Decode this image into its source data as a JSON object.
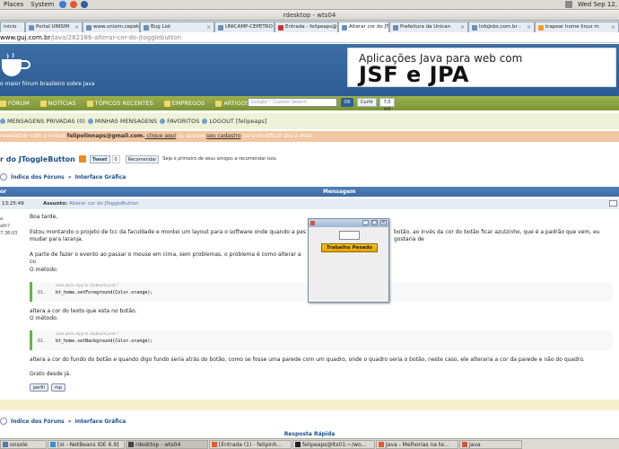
{
  "gnome": {
    "menus": [
      "Places",
      "System"
    ],
    "clock": "Wed Sep 12,"
  },
  "window_title": "rdesktop - wts04",
  "browser": {
    "tabs": [
      {
        "label": "inicio"
      },
      {
        "label": "Portal UNISIM"
      },
      {
        "label": "www.unisim.cepetro"
      },
      {
        "label": "Bug List"
      },
      {
        "label": "UNICAMP-CEPETRO"
      },
      {
        "label": "Entrada - felipeaps@"
      },
      {
        "label": "Alterar cor do JTogg"
      },
      {
        "label": "Prefeitura da Unican"
      },
      {
        "label": "InfoJobs.com.br -"
      },
      {
        "label": "trapear home linux m"
      }
    ],
    "url_host": "www.guj.com.br",
    "url_path": "/java/282186-alterar-cor-do-jtogglebutton"
  },
  "site": {
    "tagline": "o maior fórum brasileiro sobre Java",
    "ad_line1": "Aplicações Java para web com",
    "ad_line2": "JSF e JPA",
    "nav": [
      "FÓRUM",
      "NOTÍCIAS",
      "TÓPICOS RECENTES",
      "EMPREGOS",
      "ARTIGOS"
    ],
    "search_placeholder": "Google™ Custom Search",
    "ok_label": "OK",
    "curtir_label": "Curtir",
    "curtir_count": "7,0 mil",
    "user_links": [
      "MENSAGENS PRIVADAS (0)",
      "MINHAS MENSAGENS",
      "FAVORITOS",
      "LOGOUT [felipeaps]"
    ],
    "notice_pre": "newsletter com o e-mail ",
    "notice_email": "felipolinnaps@gmail.com.",
    "notice_mid1": " clique aqui",
    "notice_mid2": " ou acesse ",
    "notice_link": "seu cadastro",
    "notice_post": " para modificar seu e-mail."
  },
  "topic": {
    "title": "r do JToggleButton",
    "tweet": "Tweet",
    "tweet_count": "0",
    "recomendar": "Recomendar",
    "rec_text": "Seja o primeiro de seus amigos a recomendar isso.",
    "crumb1": "Índice dos Fóruns",
    "crumb_sep": "»",
    "crumb2": "Interface Gráfica",
    "col_author": "or",
    "col_msg": "Mensagem",
    "post_time": "13:25:49",
    "assunto_label": "Assunto:",
    "assunto_value": "Alterar cor do JToggleButton",
    "author_snips": [
      "a",
      "ath?",
      "7:38:03"
    ]
  },
  "post": {
    "p1": "Boa tarde,",
    "p2": "Estou montando o projeto de tcc da faculdade e montei um layout para o software onde quando a pes",
    "p2b": "botão, ao invés da cor do botão ficar azulzinho, que é a padrão que vem, eu gostaria de",
    "p2c": "mudar para laranja.",
    "p3": "A parte de fazer o evento ao passar o mouse em cima, sem problemas, o problema é como alterar a co",
    "p4": "O método:",
    "code_links": "view plain   copy to clipboard   print   ?",
    "code1_num": "01.",
    "code1": "bt_home.setForeground(Color.orange);",
    "p5": "altera a cor do texto que esta no botão.",
    "p6": "O método:",
    "code2_num": "01.",
    "code2": "bt_home.setBackground(Color.orange);",
    "p7": "altera a cor do fundo do botão e quando digo fundo seria atrás do botão, como se fosse uma parede com um quadro, onde o quadro seria o botão, neste caso, ele alteraria a cor da parede e não do quadro.",
    "p8": "Grato desde já.",
    "btn_perfil": "perfil",
    "btn_mp": "mp"
  },
  "quick_reply": "Resposta Rápida",
  "jframe": {
    "button_label": "Trabalho Pesado",
    "min": "_",
    "max": "□",
    "close": "×"
  },
  "taskbar": [
    {
      "label": "onsole"
    },
    {
      "label": "[oi - NetBeans IDE 6.9]"
    },
    {
      "label": "rdesktop - wts04"
    },
    {
      "label": "[Entrada (1) - felipinh..."
    },
    {
      "label": "felipeaps@lts01:~/wo..."
    },
    {
      "label": "Java - Melhorias na te..."
    },
    {
      "label": "Java"
    }
  ]
}
